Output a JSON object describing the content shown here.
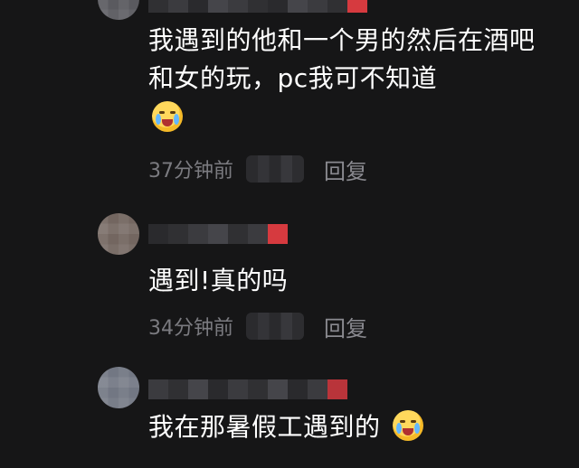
{
  "comments": [
    {
      "text": "我遇到的他和一个男的然后在酒吧和女的玩，pc我可不知道",
      "time": "37分钟前",
      "reply": "回复"
    },
    {
      "text": "遇到!真的吗",
      "time": "34分钟前",
      "reply": "回复"
    },
    {
      "text": "我在那暑假工遇到的"
    }
  ],
  "icons": {
    "reaction_emoji": "crying-face-icon"
  },
  "colors": {
    "background": "#161617",
    "text": "#ffffff",
    "meta_text": "#7b7b80",
    "accent_red": "#d63a3f"
  }
}
